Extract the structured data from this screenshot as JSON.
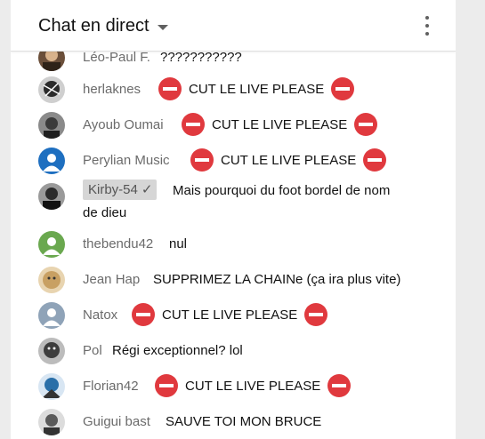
{
  "header": {
    "title": "Chat en direct"
  },
  "messages": [
    {
      "author": "Léo-Paul F.",
      "text": "???????????",
      "avatar_color": "#6b4f3a",
      "has_icons": false
    },
    {
      "author": "herlaknes",
      "text": "CUT LE LIVE PLEASE",
      "avatar_color": "#3a3a3a",
      "has_icons": true
    },
    {
      "author": "Ayoub Oumai",
      "text": "CUT LE LIVE PLEASE",
      "avatar_color": "#404040",
      "has_icons": true
    },
    {
      "author": "Perylian Music",
      "text": "CUT LE LIVE PLEASE",
      "avatar_color": "#1e6fc0",
      "has_icons": true
    },
    {
      "author": "Kirby-54",
      "text_line1": "Mais pourquoi du foot bordel de nom",
      "text_line2": "de dieu",
      "avatar_color": "#2b2b2b",
      "moderator_check": "✓"
    },
    {
      "author": "thebendu42",
      "text": "nul",
      "avatar_color": "#6aa84f",
      "has_icons": false
    },
    {
      "author": "Jean Hap",
      "text": "SUPPRIMEZ LA CHAINe (ça ira plus vite)",
      "avatar_color": "#c8a063",
      "has_icons": false
    },
    {
      "author": "Natox",
      "text": "CUT LE LIVE PLEASE",
      "avatar_color": "#8fa3b8",
      "has_icons": true
    },
    {
      "author": "Pol",
      "text": "Régi exceptionnel? lol",
      "avatar_color": "#3d3d3d",
      "has_icons": false
    },
    {
      "author": "Florian42",
      "text": "CUT LE LIVE PLEASE",
      "avatar_color": "#2a6fa8",
      "has_icons": true
    },
    {
      "author": "Guigui bast",
      "text": "SAUVE TOI MON BRUCE",
      "avatar_color": "#5a5a5a",
      "has_icons": false
    }
  ],
  "icons": {
    "no_entry": "no-entry-emoji",
    "menu": "kebab-menu-icon",
    "dropdown": "caret-down-icon"
  },
  "colors": {
    "no_entry_red": "#e0393e",
    "author_gray": "#6b6b6b",
    "moderator_badge_bg": "#d6d6d6"
  }
}
